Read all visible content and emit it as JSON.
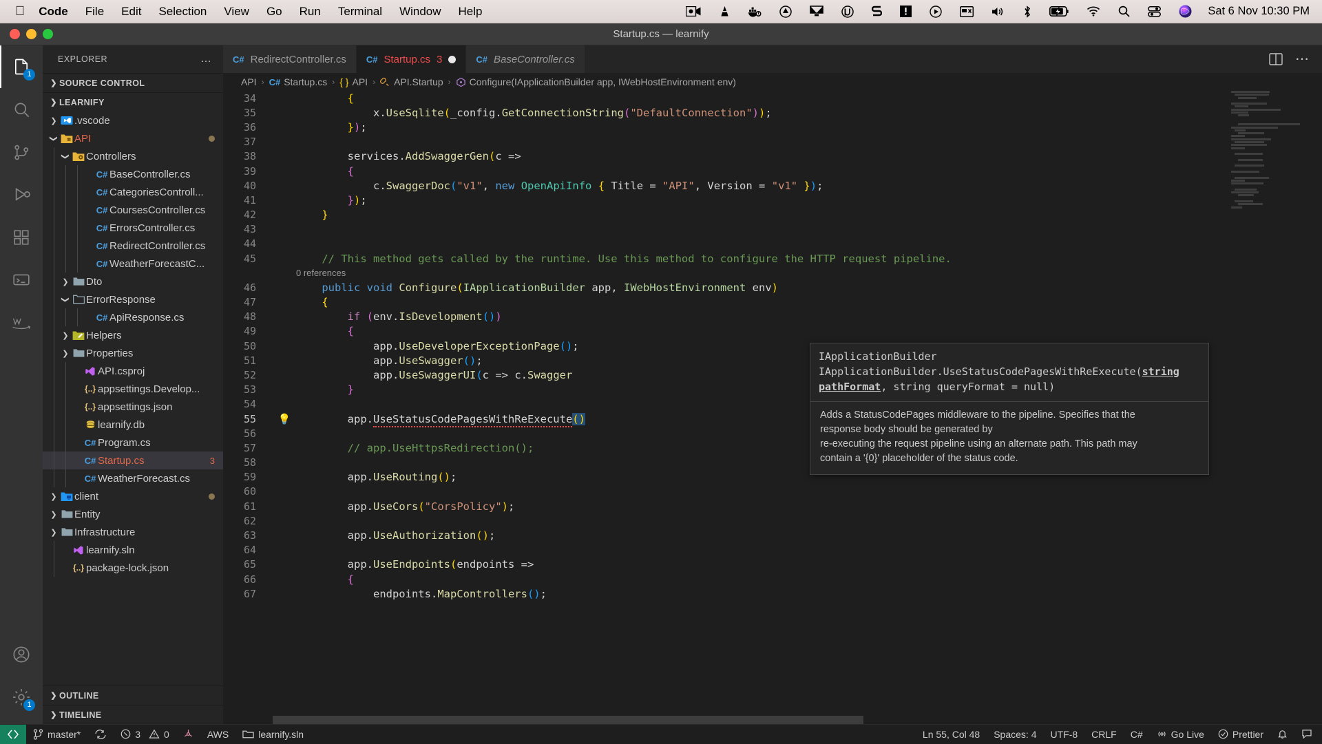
{
  "macos": {
    "apple_menu": "",
    "menus": [
      {
        "label": "Code",
        "bold": true
      },
      {
        "label": "File",
        "bold": false
      },
      {
        "label": "Edit",
        "bold": false
      },
      {
        "label": "Selection",
        "bold": false
      },
      {
        "label": "View",
        "bold": false
      },
      {
        "label": "Go",
        "bold": false
      },
      {
        "label": "Run",
        "bold": false
      },
      {
        "label": "Terminal",
        "bold": false
      },
      {
        "label": "Window",
        "bold": false
      },
      {
        "label": "Help",
        "bold": false
      }
    ],
    "tray_icons": [
      "screen-recorder-icon",
      "vlc-cone-icon",
      "docker-icon",
      "cleanmymac-icon",
      "display-icon",
      "utorrent-icon",
      "sketch-icon",
      "warning-box-icon",
      "play-circle-icon",
      "screenshot-icon",
      "volume-icon",
      "bluetooth-icon",
      "battery-charging-icon",
      "wifi-icon",
      "spotlight-search-icon",
      "control-center-icon",
      "siri-icon"
    ],
    "clock": "Sat 6 Nov  10:30 PM"
  },
  "window": {
    "title": "Startup.cs — learnify"
  },
  "activitybar": {
    "items": [
      {
        "name": "explorer",
        "badge": "1",
        "active": true
      },
      {
        "name": "search",
        "badge": "",
        "active": false
      },
      {
        "name": "source-control",
        "badge": "",
        "active": false
      },
      {
        "name": "run-and-debug",
        "badge": "",
        "active": false
      },
      {
        "name": "extensions",
        "badge": "",
        "active": false
      },
      {
        "name": "remote-explorer",
        "badge": "",
        "active": false
      },
      {
        "name": "aws-toolkit",
        "badge": "",
        "active": false
      }
    ],
    "bottom": [
      {
        "name": "accounts",
        "badge": ""
      },
      {
        "name": "settings",
        "badge": "1"
      }
    ]
  },
  "sidebar": {
    "title": "EXPLORER",
    "more_actions": "…",
    "sections": [
      {
        "label": "SOURCE CONTROL",
        "expanded": false
      },
      {
        "label": "LEARNIFY",
        "expanded": true
      }
    ],
    "bottom_panes": [
      {
        "label": "OUTLINE",
        "expanded": false
      },
      {
        "label": "TIMELINE",
        "expanded": false
      }
    ],
    "tree": [
      {
        "label": ".vscode",
        "icon": "folder-vscode",
        "indent": 1,
        "arrow": "collapsed",
        "type": "folder"
      },
      {
        "label": "API",
        "icon": "folder-api",
        "indent": 1,
        "arrow": "expanded",
        "type": "folder",
        "modified": true,
        "color": "mod"
      },
      {
        "label": "Controllers",
        "icon": "folder-controllers",
        "indent": 2,
        "arrow": "expanded",
        "type": "folder"
      },
      {
        "label": "BaseController.cs",
        "icon": "csharp",
        "indent": 4,
        "arrow": "",
        "type": "file"
      },
      {
        "label": "CategoriesControll...",
        "icon": "csharp",
        "indent": 4,
        "arrow": "",
        "type": "file"
      },
      {
        "label": "CoursesController.cs",
        "icon": "csharp",
        "indent": 4,
        "arrow": "",
        "type": "file"
      },
      {
        "label": "ErrorsController.cs",
        "icon": "csharp",
        "indent": 4,
        "arrow": "",
        "type": "file"
      },
      {
        "label": "RedirectController.cs",
        "icon": "csharp",
        "indent": 4,
        "arrow": "",
        "type": "file"
      },
      {
        "label": "WeatherForecastC...",
        "icon": "csharp",
        "indent": 4,
        "arrow": "",
        "type": "file"
      },
      {
        "label": "Dto",
        "icon": "folder-plain",
        "indent": 2,
        "arrow": "collapsed",
        "type": "folder"
      },
      {
        "label": "ErrorResponse",
        "icon": "folder-plain-open",
        "indent": 2,
        "arrow": "expanded",
        "type": "folder"
      },
      {
        "label": "ApiResponse.cs",
        "icon": "csharp",
        "indent": 4,
        "arrow": "",
        "type": "file"
      },
      {
        "label": "Helpers",
        "icon": "folder-helpers",
        "indent": 2,
        "arrow": "collapsed",
        "type": "folder"
      },
      {
        "label": "Properties",
        "icon": "folder-plain",
        "indent": 2,
        "arrow": "collapsed",
        "type": "folder"
      },
      {
        "label": "API.csproj",
        "icon": "visualstudio",
        "indent": 3,
        "arrow": "",
        "type": "file"
      },
      {
        "label": "appsettings.Develop...",
        "icon": "json",
        "indent": 3,
        "arrow": "",
        "type": "file"
      },
      {
        "label": "appsettings.json",
        "icon": "json",
        "indent": 3,
        "arrow": "",
        "type": "file"
      },
      {
        "label": "learnify.db",
        "icon": "database",
        "indent": 3,
        "arrow": "",
        "type": "file"
      },
      {
        "label": "Program.cs",
        "icon": "csharp",
        "indent": 3,
        "arrow": "",
        "type": "file"
      },
      {
        "label": "Startup.cs",
        "icon": "csharp",
        "indent": 3,
        "arrow": "",
        "type": "file",
        "selected": true,
        "color": "mod",
        "badge": "3"
      },
      {
        "label": "WeatherForecast.cs",
        "icon": "csharp",
        "indent": 3,
        "arrow": "",
        "type": "file"
      },
      {
        "label": "client",
        "icon": "folder-client",
        "indent": 1,
        "arrow": "collapsed",
        "type": "folder",
        "modified": true
      },
      {
        "label": "Entity",
        "icon": "folder-plain",
        "indent": 1,
        "arrow": "collapsed",
        "type": "folder"
      },
      {
        "label": "Infrastructure",
        "icon": "folder-plain",
        "indent": 1,
        "arrow": "collapsed",
        "type": "folder"
      },
      {
        "label": "learnify.sln",
        "icon": "visualstudio",
        "indent": 2,
        "arrow": "",
        "type": "file"
      },
      {
        "label": "package-lock.json",
        "icon": "json",
        "indent": 2,
        "arrow": "",
        "type": "file"
      }
    ]
  },
  "tabs": [
    {
      "label": "RedirectController.cs",
      "icon": "csharp",
      "active": false,
      "italic": false,
      "errors": "",
      "dirty": false
    },
    {
      "label": "Startup.cs",
      "icon": "csharp",
      "active": true,
      "italic": false,
      "errors": "3",
      "dirty": true
    },
    {
      "label": "BaseController.cs",
      "icon": "csharp",
      "active": false,
      "italic": true,
      "errors": "",
      "dirty": false
    }
  ],
  "editor_actions": [
    {
      "name": "split-editor-right-icon"
    },
    {
      "name": "more-actions-icon"
    }
  ],
  "breadcrumbs": [
    {
      "label": "API",
      "icon": ""
    },
    {
      "label": "Startup.cs",
      "icon": "csharp"
    },
    {
      "label": "API",
      "icon": "namespace"
    },
    {
      "label": "API.Startup",
      "icon": "class"
    },
    {
      "label": "Configure(IApplicationBuilder app, IWebHostEnvironment env)",
      "icon": "method"
    }
  ],
  "code": {
    "first_visible_line": 34,
    "reference_lens": "0 references",
    "lines": [
      {
        "n": 34,
        "html": "        <span class=\"br-y\">{</span>"
      },
      {
        "n": 35,
        "html": "            x<span class=\"c-plain\">.</span><span class=\"c-fn\">UseSqlite</span><span class=\"br-y\">(</span>_config<span class=\"c-plain\">.</span><span class=\"c-fn\">GetConnectionString</span><span class=\"br-p\">(</span><span class=\"c-str\">\"DefaultConnection\"</span><span class=\"br-p\">)</span><span class=\"br-y\">)</span>;"
      },
      {
        "n": 36,
        "html": "        <span class=\"br-y\">}</span><span class=\"br-p\">)</span>;"
      },
      {
        "n": 37,
        "html": ""
      },
      {
        "n": 38,
        "html": "        services<span class=\"c-plain\">.</span><span class=\"c-fn\">AddSwaggerGen</span><span class=\"br-y\">(</span>c <span class=\"c-plain\">=&gt;</span>"
      },
      {
        "n": 39,
        "html": "        <span class=\"br-p\">{</span>"
      },
      {
        "n": 40,
        "html": "            c<span class=\"c-plain\">.</span><span class=\"c-fn\">SwaggerDoc</span><span class=\"br-b\">(</span><span class=\"c-str\">\"v1\"</span>, <span class=\"c-kw\">new</span> <span class=\"c-type\">OpenApiInfo</span> <span class=\"br-y\">{</span> Title <span class=\"c-plain\">=</span> <span class=\"c-str\">\"API\"</span>, Version <span class=\"c-plain\">=</span> <span class=\"c-str\">\"v1\"</span> <span class=\"br-y\">}</span><span class=\"br-b\">)</span>;"
      },
      {
        "n": 41,
        "html": "        <span class=\"br-p\">}</span><span class=\"br-y\">)</span>;"
      },
      {
        "n": 42,
        "html": "    <span class=\"br-y\">}</span>"
      },
      {
        "n": 43,
        "html": ""
      },
      {
        "n": 44,
        "html": ""
      },
      {
        "n": 45,
        "html": "    <span class=\"c-com\">// This method gets called by the runtime. Use this method to configure the HTTP request pipeline.</span>"
      },
      {
        "n": 46,
        "html": "    <span class=\"c-kw\">public</span> <span class=\"c-kw\">void</span> <span class=\"c-fn\">Configure</span><span class=\"br-y\">(</span><span class=\"c-iface\">IApplicationBuilder</span> <span class=\"c-plain\">app</span>, <span class=\"c-iface\">IWebHostEnvironment</span> <span class=\"c-plain\">env</span><span class=\"br-y\">)</span>"
      },
      {
        "n": 47,
        "html": "    <span class=\"br-y\">{</span>"
      },
      {
        "n": 48,
        "html": "        <span class=\"c-kw2\">if</span> <span class=\"br-p\">(</span>env<span class=\"c-plain\">.</span><span class=\"c-fn\">IsDevelopment</span><span class=\"br-b\">()</span><span class=\"br-p\">)</span>"
      },
      {
        "n": 49,
        "html": "        <span class=\"br-p\">{</span>"
      },
      {
        "n": 50,
        "html": "            app<span class=\"c-plain\">.</span><span class=\"c-fn\">UseDeveloperExceptionPage</span><span class=\"br-b\">()</span>;"
      },
      {
        "n": 51,
        "html": "            app<span class=\"c-plain\">.</span><span class=\"c-fn\">UseSwagger</span><span class=\"br-b\">()</span>;"
      },
      {
        "n": 52,
        "html": "            app<span class=\"c-plain\">.</span><span class=\"c-fn\">UseSwaggerUI</span><span class=\"br-b\">(</span>c <span class=\"c-plain\">=&gt;</span> c<span class=\"c-plain\">.</span><span class=\"c-fn\">Swagger</span>"
      },
      {
        "n": 53,
        "html": "        <span class=\"br-p\">}</span>"
      },
      {
        "n": 54,
        "html": ""
      },
      {
        "n": 55,
        "html": "        app<span class=\"c-plain\">.</span><span class=\"sqerr\">UseStatusCodePagesWithReExecute</span><span class=\"br-y selbox\">()</span>",
        "active": true,
        "lightbulb": true
      },
      {
        "n": 56,
        "html": ""
      },
      {
        "n": 57,
        "html": "        <span class=\"c-com\">// app.UseHttpsRedirection();</span>"
      },
      {
        "n": 58,
        "html": ""
      },
      {
        "n": 59,
        "html": "        app<span class=\"c-plain\">.</span><span class=\"c-fn\">UseRouting</span><span class=\"br-y\">()</span>;"
      },
      {
        "n": 60,
        "html": ""
      },
      {
        "n": 61,
        "html": "        app<span class=\"c-plain\">.</span><span class=\"c-fn\">UseCors</span><span class=\"br-y\">(</span><span class=\"c-str\">\"CorsPolicy\"</span><span class=\"br-y\">)</span>;"
      },
      {
        "n": 62,
        "html": ""
      },
      {
        "n": 63,
        "html": "        app<span class=\"c-plain\">.</span><span class=\"c-fn\">UseAuthorization</span><span class=\"br-y\">()</span>;"
      },
      {
        "n": 64,
        "html": ""
      },
      {
        "n": 65,
        "html": "        app<span class=\"c-plain\">.</span><span class=\"c-fn\">UseEndpoints</span><span class=\"br-y\">(</span>endpoints <span class=\"c-plain\">=&gt;</span>"
      },
      {
        "n": 66,
        "html": "        <span class=\"br-p\">{</span>"
      },
      {
        "n": 67,
        "html": "            endpoints<span class=\"c-plain\">.</span><span class=\"c-fn\">MapControllers</span><span class=\"br-b\">()</span>;"
      }
    ]
  },
  "hover": {
    "type_line": "IApplicationBuilder",
    "signature_prefix": "IApplicationBuilder.UseStatusCodePagesWithReExecute(",
    "signature_param_bold": "string pathFormat",
    "signature_suffix": ", string queryFormat = null)",
    "doc_lines": [
      "Adds a StatusCodePages middleware to the pipeline. Specifies that the",
      "response body should be generated by",
      "re-executing the request pipeline using an alternate path. This path may",
      "contain a '{0}' placeholder of the status code."
    ]
  },
  "statusbar": {
    "remote_label": "",
    "branch": "master*",
    "sync_icon": "sync-icon",
    "errors": "3",
    "warnings": "0",
    "radioactive_icon": "radiation-icon",
    "aws": "AWS",
    "solution": "learnify.sln",
    "cursor": "Ln 55, Col 48",
    "indent": "Spaces: 4",
    "encoding": "UTF-8",
    "eol": "CRLF",
    "language": "C#",
    "golive": "Go Live",
    "prettier": "Prettier",
    "bell_icon": "bell-icon",
    "feedback_icon": "feedback-icon"
  }
}
